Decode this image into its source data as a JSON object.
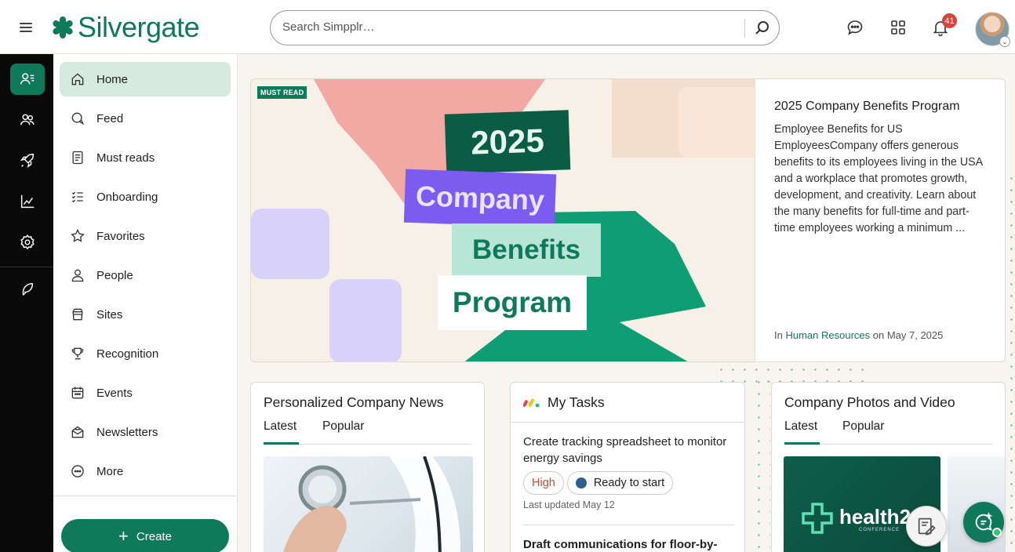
{
  "brand": {
    "name": "Silvergate",
    "color": "#0f7a5a"
  },
  "search": {
    "placeholder": "Search Simpplr…"
  },
  "topbar": {
    "icons": [
      "chat-icon",
      "apps-grid-icon",
      "bell-icon"
    ],
    "notification_count": "41"
  },
  "rail": {
    "items": [
      "people-list-icon",
      "group-icon",
      "rocket-icon",
      "analytics-icon",
      "gear-icon",
      "feather-icon"
    ]
  },
  "nav": {
    "items": [
      {
        "label": "Home",
        "icon": "home-icon"
      },
      {
        "label": "Feed",
        "icon": "feed-icon"
      },
      {
        "label": "Must reads",
        "icon": "must-reads-icon"
      },
      {
        "label": "Onboarding",
        "icon": "checklist-icon"
      },
      {
        "label": "Favorites",
        "icon": "star-icon"
      },
      {
        "label": "People",
        "icon": "person-icon"
      },
      {
        "label": "Sites",
        "icon": "sites-icon"
      },
      {
        "label": "Recognition",
        "icon": "trophy-icon"
      },
      {
        "label": "Events",
        "icon": "calendar-icon"
      },
      {
        "label": "Newsletters",
        "icon": "newsletter-icon"
      },
      {
        "label": "More",
        "icon": "more-icon"
      }
    ],
    "create_label": "Create"
  },
  "hero": {
    "badge": "MUST READ",
    "art": {
      "line1": "2025",
      "line2": "Company",
      "line3": "Benefits",
      "line4": "Program"
    },
    "title": "2025 Company Benefits Program",
    "body": "Employee Benefits for US EmployeesCompany offers generous benefits to its employees living in the USA and a workplace that promotes growth, development, and creativity. Learn about the many benefits for full-time and part-time employees working a minimum ...",
    "meta_in": "In",
    "meta_site": "Human Resources",
    "meta_date": "on May 7, 2025"
  },
  "news": {
    "title": "Personalized Company News",
    "tabs": [
      "Latest",
      "Popular"
    ]
  },
  "tasks": {
    "title": "My Tasks",
    "items": [
      {
        "title": "Create tracking spreadsheet to monitor energy savings",
        "priority": "High",
        "status": "Ready to start",
        "updated": "Last updated May 12"
      },
      {
        "title": "Draft communications for floor-by-"
      }
    ]
  },
  "photos": {
    "title": "Company Photos and Video",
    "tabs": [
      "Latest",
      "Popular"
    ],
    "thumb_text": "health2",
    "thumb_sub": "CONFERENCE"
  }
}
